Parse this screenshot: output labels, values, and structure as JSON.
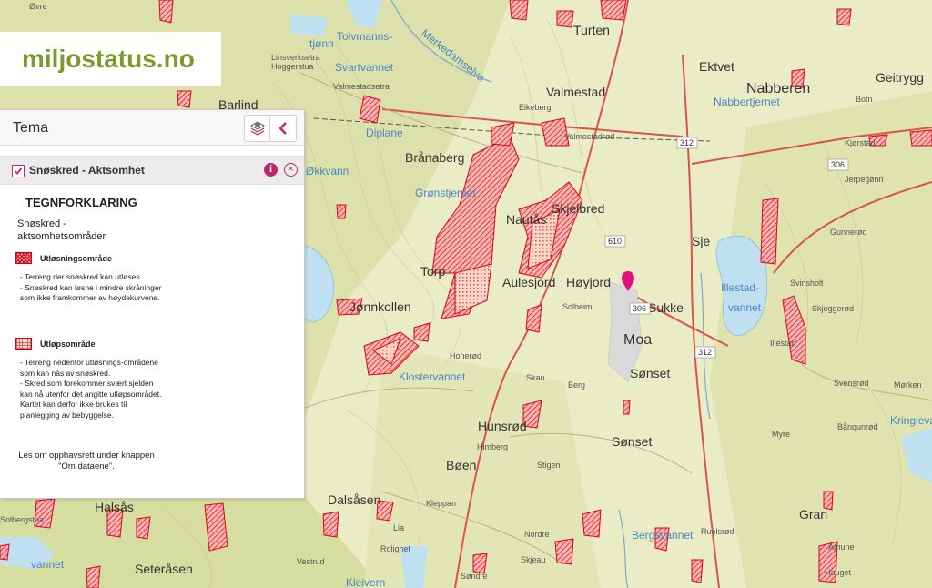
{
  "logo": {
    "text": "miljostatus.no"
  },
  "panel": {
    "title": "Tema",
    "layers_icon": "layers-icon",
    "collapse_icon": "chevron-left-icon",
    "layer": {
      "name": "Snøskred - Aktsomhet",
      "checked": true,
      "info_icon": "info-icon",
      "remove_icon": "close-circle-icon"
    },
    "legend": {
      "title": "TEGNFORKLARING",
      "subtitle": "Snøskred - aktsomhetsområder",
      "items": [
        {
          "name": "Utløsningsområde",
          "description": "- Terreng der snøskred kan utløses.\n- Snøskred kan løsne i mindre skråninger som ikke framkommer av høydekurvene."
        },
        {
          "name": "Utløpsområde",
          "description": "- Terreng nedenfor utløsnings-områdene som kan nås av snøskred.\n- Skred som forekommer svært sjelden kan nå utenfor det angitte utløpsområdet. Kartet kan derfor ikke brukes til planlegging av bebyggelse."
        }
      ],
      "copyright_note": "Les om opphavsrett under knappen \"Om dataene\"."
    }
  },
  "map": {
    "colors": {
      "land": "#e9ecc4",
      "forest": "#d7dea3",
      "water": "#bfe0f0",
      "hazard": "#e8001c",
      "road": "#d45a5a",
      "marker": "#e0107a"
    },
    "places": [
      "Øvre",
      "Turten",
      "Ektvet",
      "Nabberen",
      "Geitrygg",
      "Botn",
      "Valmestad",
      "Valmestadsetra",
      "Eikeberg",
      "Valmestadrød",
      "Kjørstad",
      "Linsverksetra",
      "Hoggerstua",
      "Barlind",
      "Brånaberg",
      "Nautås",
      "Skjelbred",
      "Sje",
      "Jerpetjønn",
      "Gunnerød",
      "Svinsholt",
      "Skjeggerød",
      "Illestad",
      "Aulesjord",
      "Høyjord",
      "Solheim",
      "Sukke",
      "Moa",
      "Sønset",
      "Honerød",
      "Skau",
      "Berg",
      "Svensrød",
      "Mørken",
      "Bångunrød",
      "Myre",
      "Hunsrød",
      "Himberg",
      "Sønset",
      "Bøen",
      "Stigen",
      "Dalsåsen",
      "Kleppan",
      "Lia",
      "Rolighet",
      "Nordre",
      "Ruelsrød",
      "Gran",
      "Amune",
      "Hauget",
      "Seteråsen",
      "Halsås",
      "Solbergstua",
      "Vestrud",
      "Skjeau",
      "Søndre",
      "Jønnkollen",
      "Torp"
    ],
    "water_names": [
      "Tolvmannstjønn",
      "Svartvannet",
      "Merkedamselva",
      "Diplane",
      "Grønstjernet",
      "Nabbertjernet",
      "Illestadvannet",
      "Klostervannet",
      "Bergsvannet",
      "Kringlevann",
      "Kleivern",
      "vannet",
      "Økkvann"
    ],
    "roads": [
      "310",
      "312",
      "306",
      "610",
      "306",
      "312"
    ]
  }
}
